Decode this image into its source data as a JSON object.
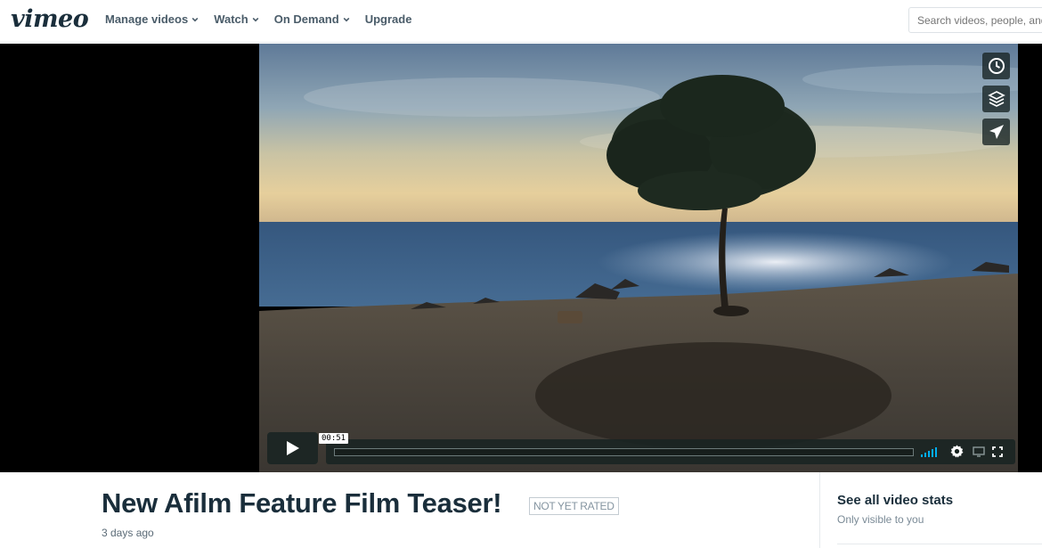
{
  "brand": {
    "logo_text": "vimeo"
  },
  "nav": {
    "items": [
      {
        "label": "Manage videos",
        "has_dropdown": true
      },
      {
        "label": "Watch",
        "has_dropdown": true
      },
      {
        "label": "On Demand",
        "has_dropdown": true
      },
      {
        "label": "Upgrade",
        "has_dropdown": false
      }
    ]
  },
  "search": {
    "placeholder": "Search videos, people, and more"
  },
  "player": {
    "timecode": "00:51",
    "progress": 0,
    "side_buttons": [
      "clock-icon",
      "layers-icon",
      "send-icon"
    ],
    "controls": [
      "volume-icon",
      "settings-gear-icon",
      "pip-icon",
      "fullscreen-icon"
    ],
    "accent_color": "#00adef"
  },
  "video_info": {
    "title": "New Afilm Feature Film Teaser!",
    "rating_badge": "NOT YET RATED",
    "posted": "3 days ago"
  },
  "sidebar": {
    "stats_link": "See all video stats",
    "stats_note": "Only visible to you"
  }
}
